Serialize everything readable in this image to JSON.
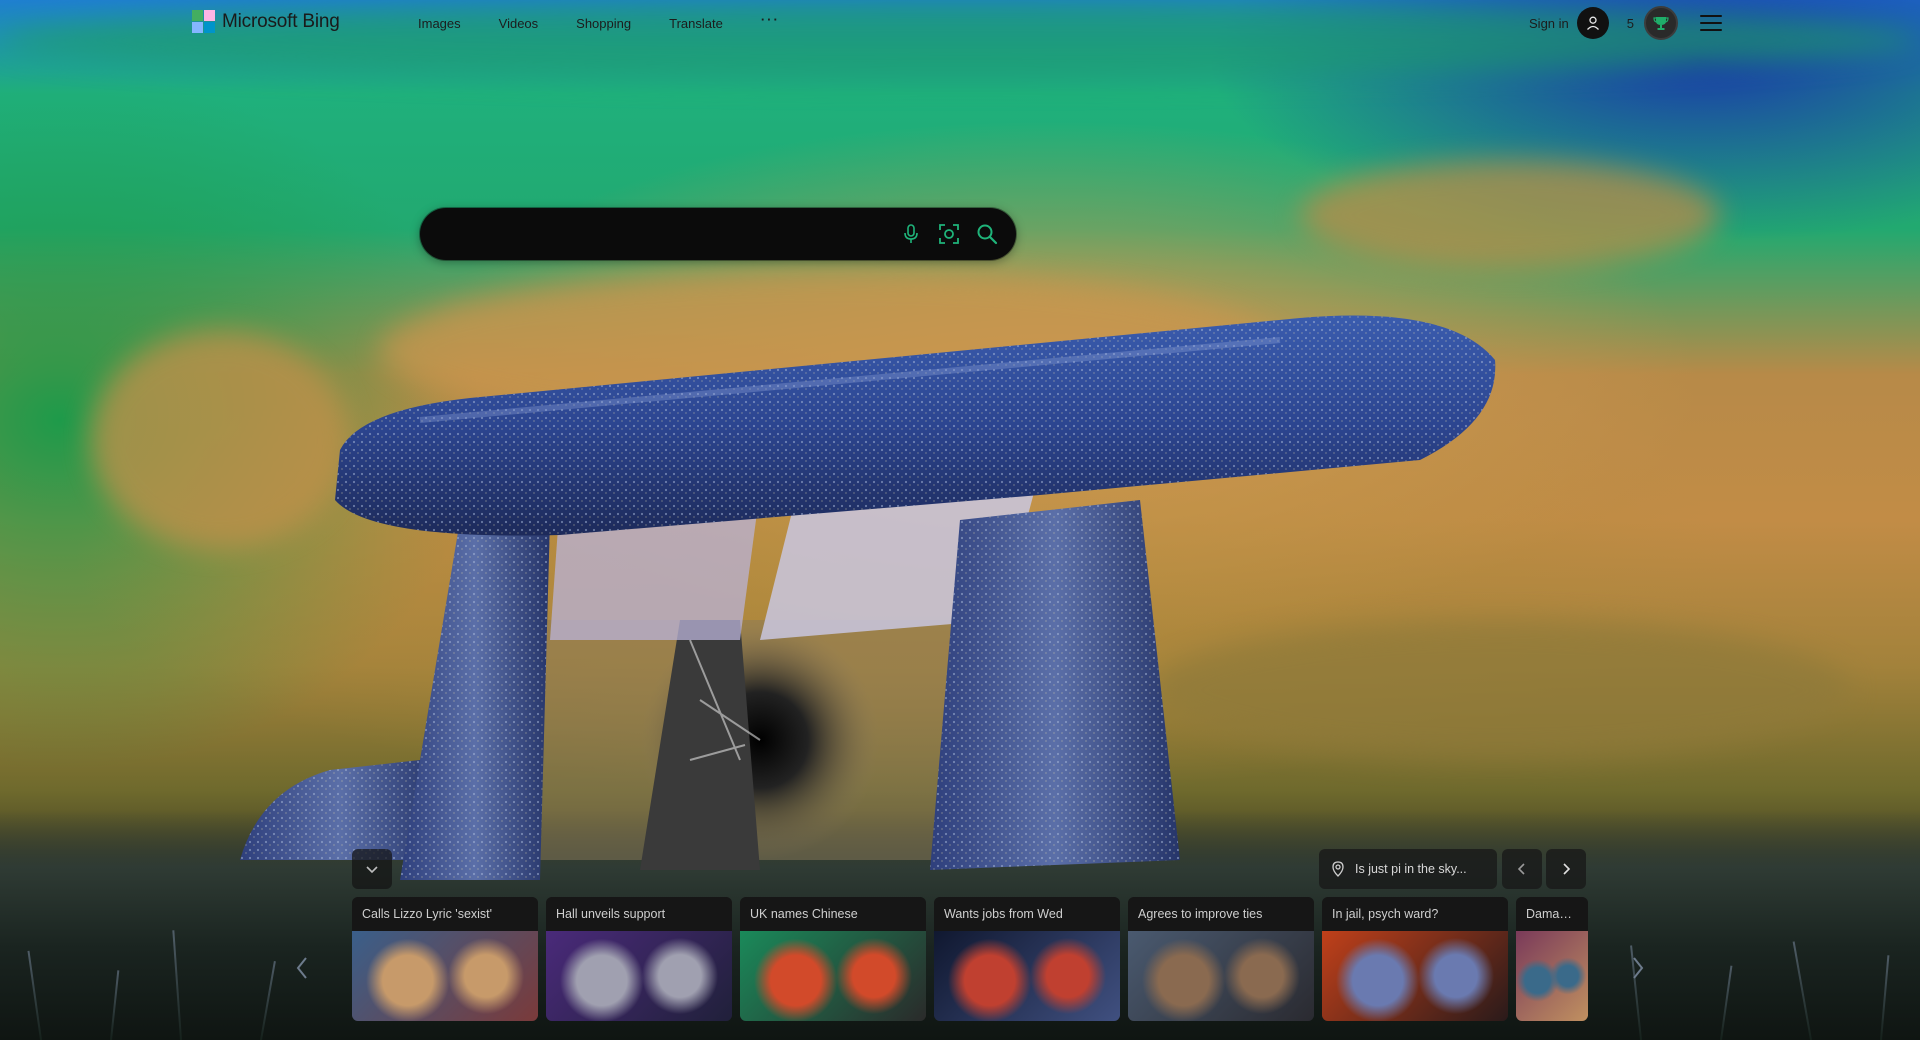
{
  "brand": {
    "name": "Microsoft Bing"
  },
  "nav": {
    "items": [
      {
        "label": "Images"
      },
      {
        "label": "Videos"
      },
      {
        "label": "Shopping"
      },
      {
        "label": "Translate"
      }
    ],
    "more_label": "···"
  },
  "account": {
    "signin_label": "Sign in",
    "points": "5"
  },
  "search": {
    "value": "",
    "placeholder": ""
  },
  "icons": {
    "mic": "microphone-icon",
    "visual": "visual-search-icon",
    "search": "search-icon",
    "avatar": "user-avatar-icon",
    "rewards": "rewards-trophy-icon",
    "menu": "hamburger-menu-icon",
    "collapse": "chevron-down-icon",
    "location": "location-pin-icon",
    "prev": "chevron-left-icon",
    "next": "chevron-right-icon"
  },
  "image_info": {
    "text": "Is just pi in the sky..."
  },
  "news": {
    "cards": [
      {
        "title": "Calls Lizzo Lyric 'sexist'",
        "palette": [
          "#3a5f8a",
          "#c79a6a",
          "#7a3a3a"
        ]
      },
      {
        "title": "Hall unveils support",
        "palette": [
          "#4a2a7a",
          "#a0a0b0",
          "#20203a"
        ]
      },
      {
        "title": "UK names Chinese",
        "palette": [
          "#1a8a5a",
          "#d24a2a",
          "#2a2a2a"
        ]
      },
      {
        "title": "Wants jobs from Wed",
        "palette": [
          "#101830",
          "#c04030",
          "#405080"
        ]
      },
      {
        "title": "Agrees to improve ties",
        "palette": [
          "#4a5a70",
          "#8a6a50",
          "#2a2a30"
        ]
      },
      {
        "title": "In jail, psych ward?",
        "palette": [
          "#c0401a",
          "#6a7ab0",
          "#2a1a1a"
        ]
      },
      {
        "title": "Damage fro",
        "palette": [
          "#7a3a5a",
          "#3a6a8a",
          "#c09060"
        ]
      }
    ]
  },
  "colors": {
    "search_bg": "#0b0b0b",
    "card_title_bg": "#141414"
  }
}
